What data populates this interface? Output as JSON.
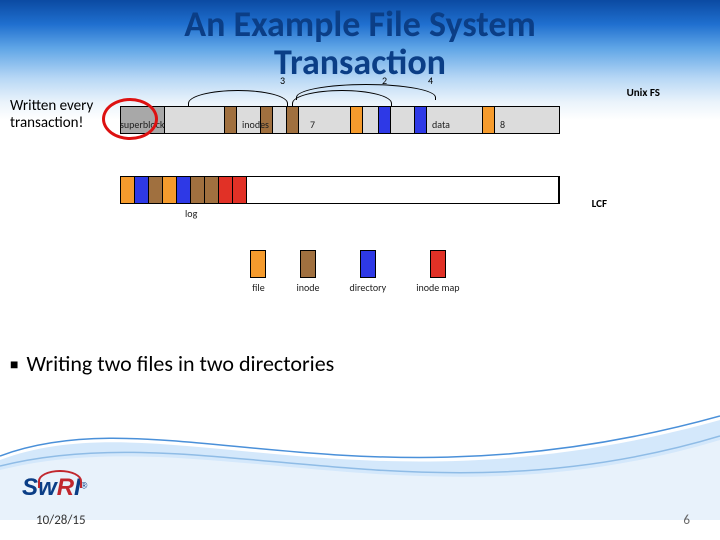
{
  "title": {
    "line1": "An Example File System",
    "line2": "Transaction"
  },
  "annotation": {
    "line1": "Written every",
    "line2": "transaction!"
  },
  "unixfs_label": "Unix FS",
  "lcf_label": "LCF",
  "arcs": {
    "a3": "3",
    "a2": "2",
    "a4": "4",
    "a7": "7",
    "a8": "8"
  },
  "sections": {
    "superblock": "superblock",
    "inodes": "inodes",
    "data": "data"
  },
  "log_label": "log",
  "legend": {
    "file": "file",
    "inode": "inode",
    "directory": "directory",
    "inode_map": "inode map"
  },
  "bullet": "Writing two files in two directories",
  "footer": {
    "date": "10/28/15",
    "page": "6"
  },
  "logo": {
    "sw": "Sw",
    "r": "R",
    "i": "I",
    "tm": "®"
  }
}
